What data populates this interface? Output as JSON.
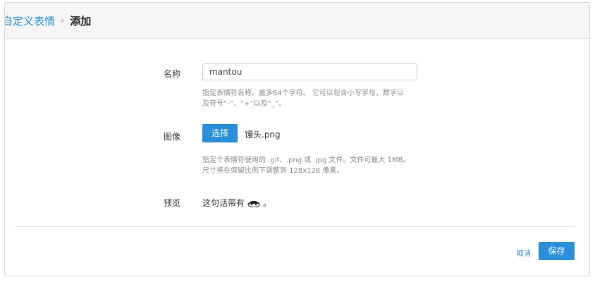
{
  "breadcrumb": {
    "parent": "自定义表情",
    "separator": "›",
    "current": "添加"
  },
  "form": {
    "name": {
      "label": "名称",
      "value": "mantou",
      "hint_line1": "指定表情符名称。最多64个字符。 它可以包含小写字母，数字以",
      "hint_line2": "及符号“-”、“+”以及“_”。"
    },
    "image": {
      "label": "图像",
      "button": "选择",
      "file_name": "馒头.png",
      "hint_line1": "指定个表情符使用的 .gif、.png 或 .jpg 文件。文件可最大 1MB。",
      "hint_line2": "尺寸将在保留比例下调整到 128x128 像素。"
    },
    "preview": {
      "label": "预览",
      "text_before": "这句话带有",
      "text_after": "。",
      "emoji_icon": "mantou-emoji-icon"
    }
  },
  "footer": {
    "cancel": "取消",
    "save": "保存"
  },
  "colors": {
    "accent": "#2a8fd8",
    "link": "#1c8ad6"
  }
}
